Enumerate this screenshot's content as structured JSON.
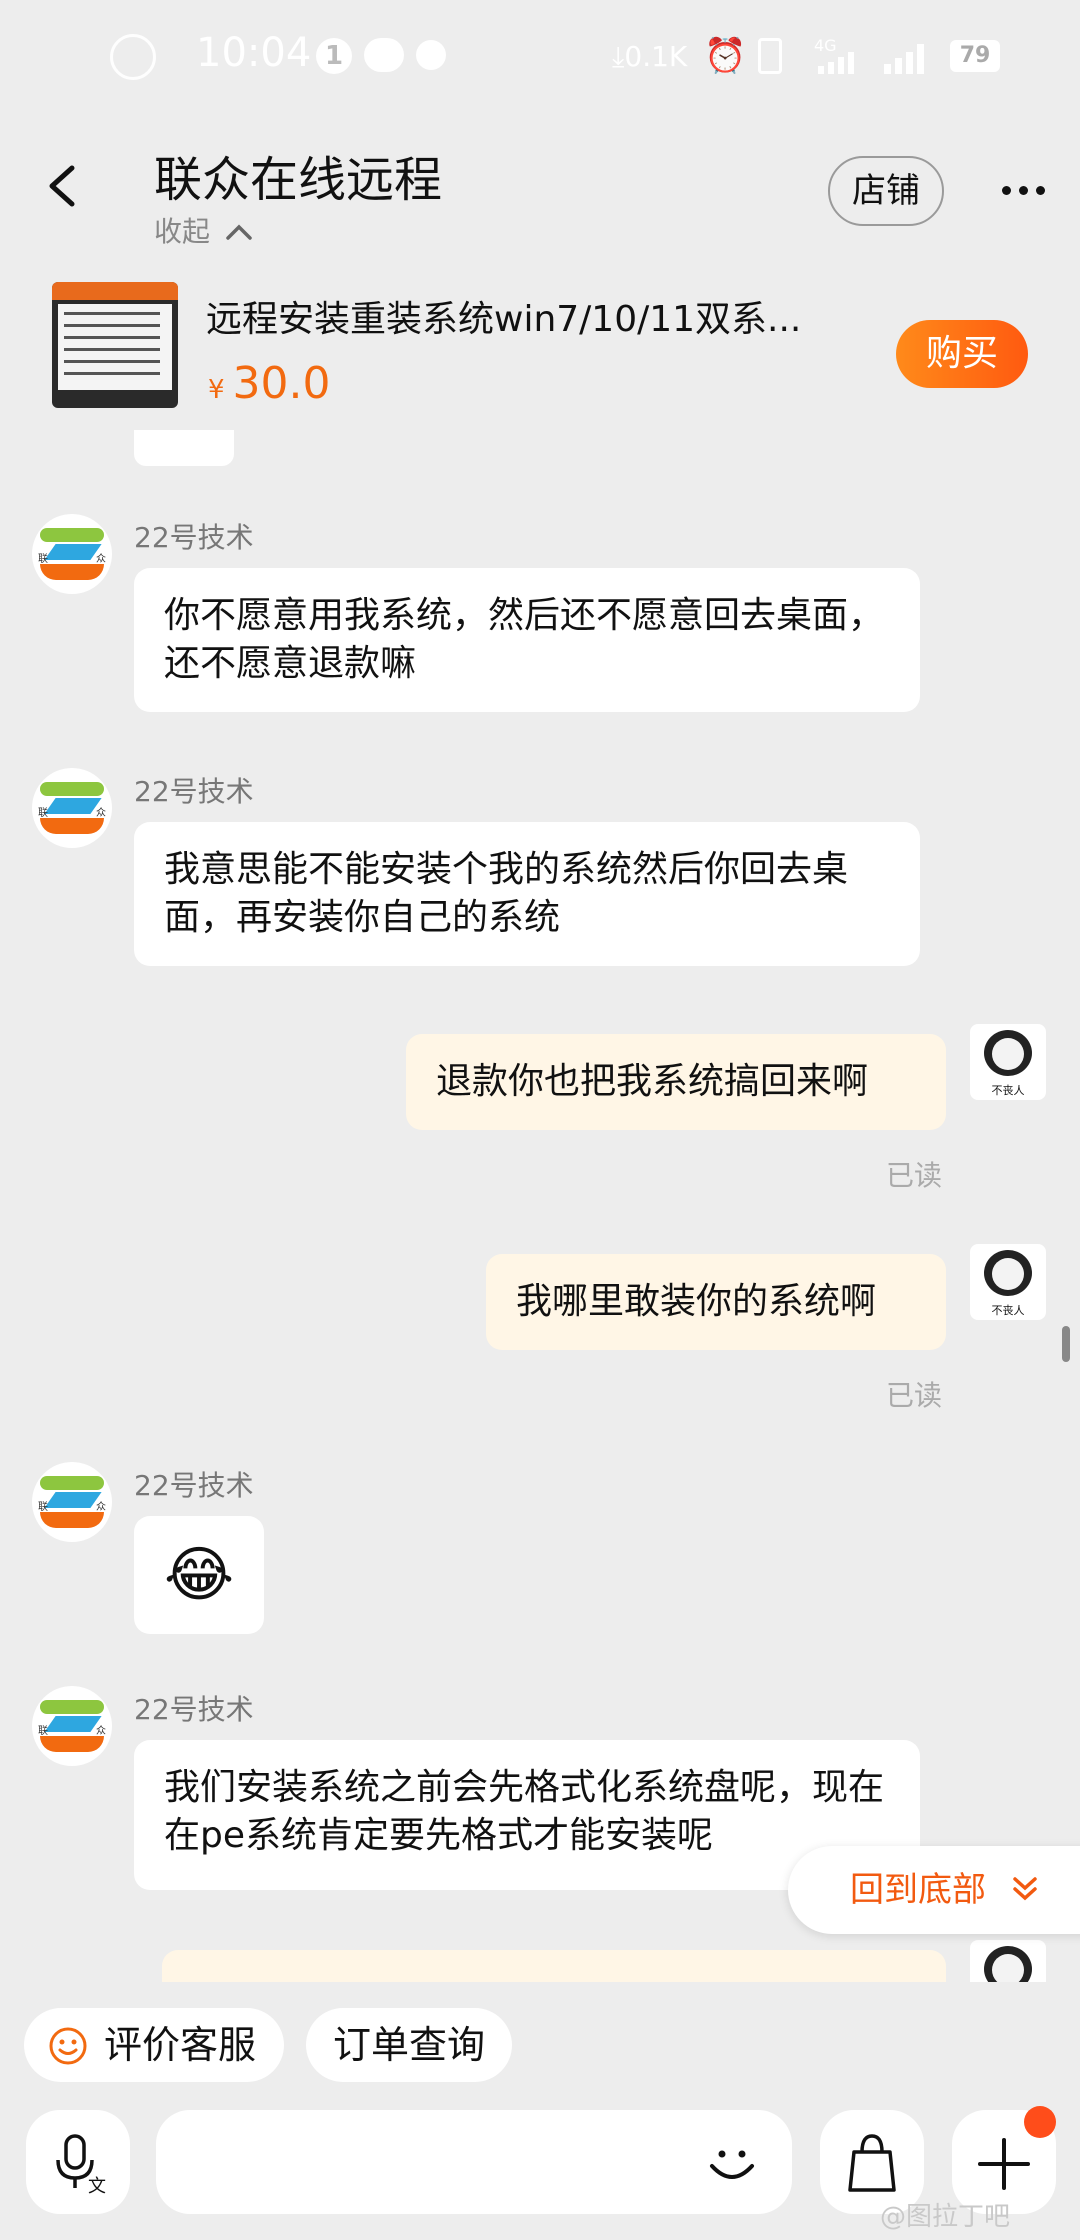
{
  "status_bar": {
    "time": "10:04",
    "notification_count": "1",
    "net_speed": "0.1K",
    "network": "4G",
    "battery": "79"
  },
  "header": {
    "title": "联众在线远程",
    "collapse_label": "收起",
    "shop_label": "店铺"
  },
  "product": {
    "title": "远程安装重装系统win7/10/11双系...",
    "currency": "¥",
    "price": "30.0",
    "buy_label": "购买"
  },
  "messages": [
    {
      "side": "left",
      "sender": "22号技术",
      "text": "你不愿意用我系统，然后还不愿意回去桌面，还不愿意退款嘛"
    },
    {
      "side": "left",
      "sender": "22号技术",
      "text": "我意思能不能安装个我的系统然后你回去桌面，再安装你自己的系统"
    },
    {
      "side": "right",
      "text": "退款你也把我系统搞回来啊",
      "status": "已读"
    },
    {
      "side": "right",
      "text": "我哪里敢装你的系统啊",
      "status": "已读"
    },
    {
      "side": "left",
      "sender": "22号技术",
      "text": "😂"
    },
    {
      "side": "left",
      "sender": "22号技术",
      "text": "我们安装系统之前会先格式化系统盘呢，现在在pe系统肯定要先格式才能安装呢"
    }
  ],
  "avatar_caption": "不丧人",
  "back_to_bottom_label": "回到底部",
  "quick_actions": {
    "evaluate": "评价客服",
    "order_query": "订单查询"
  },
  "watermark": "@图拉丁吧",
  "colors": {
    "accent": "#f26a10",
    "bubble_self": "#fff6e6",
    "background": "#ededed"
  }
}
